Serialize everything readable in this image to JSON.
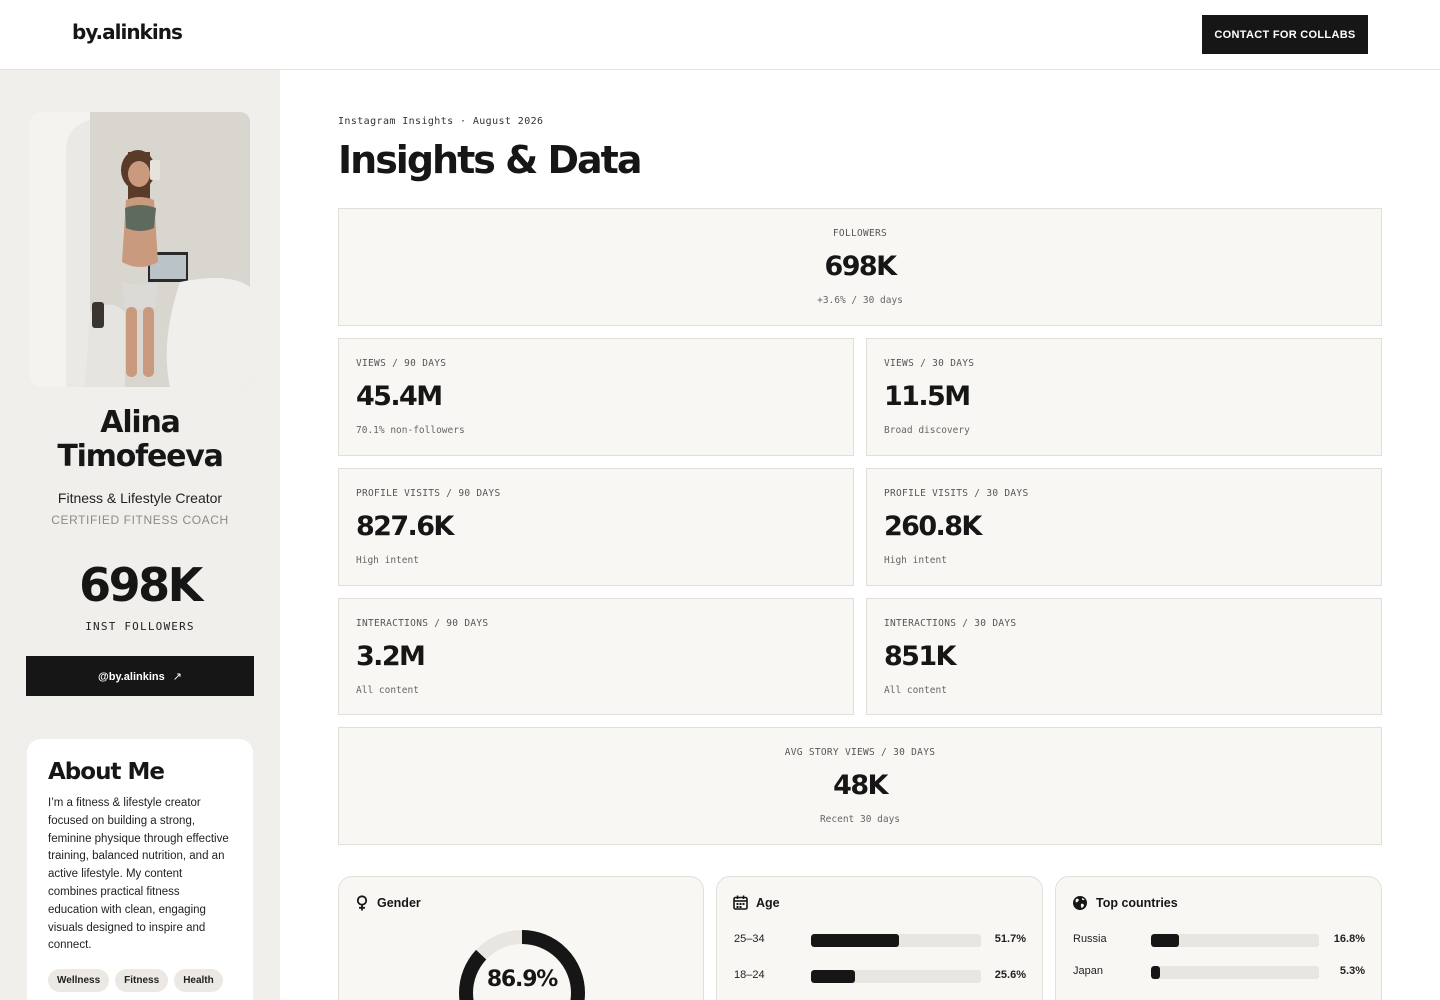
{
  "header": {
    "logo": "by.alinkins",
    "cta_label": "CONTACT FOR COLLABS"
  },
  "profile": {
    "name_line1": "Alina",
    "name_line2": "Timofeeva",
    "role": "Fitness & Lifestyle Creator",
    "certification": "CERTIFIED FITNESS COACH",
    "followers_big": "698K",
    "followers_label": "INST FOLLOWERS",
    "handle_button": "@by.alinkins",
    "handle_arrow": "↗"
  },
  "about": {
    "title": "About Me",
    "text": "I’m a fitness & lifestyle creator focused on building a strong, feminine physique through effective training, balanced nutrition, and an active lifestyle. My content combines practical fitness education with clean, engaging visuals designed to inspire and connect.",
    "tags": [
      "Wellness",
      "Fitness",
      "Health"
    ]
  },
  "main": {
    "eyebrow": "Instagram Insights · August 2026",
    "title": "Insights & Data"
  },
  "metrics": {
    "followers": {
      "label": "FOLLOWERS",
      "value": "698K",
      "sub": "+3.6% / 30 days"
    },
    "views_90": {
      "label": "VIEWS / 90 DAYS",
      "value": "45.4M",
      "sub": "70.1% non-followers"
    },
    "views_30": {
      "label": "VIEWS / 30 DAYS",
      "value": "11.5M",
      "sub": "Broad discovery"
    },
    "visits_90": {
      "label": "PROFILE VISITS / 90 DAYS",
      "value": "827.6K",
      "sub": "High intent"
    },
    "visits_30": {
      "label": "PROFILE VISITS / 30 DAYS",
      "value": "260.8K",
      "sub": "High intent"
    },
    "interactions_90": {
      "label": "INTERACTIONS / 90 DAYS",
      "value": "3.2M",
      "sub": "All content"
    },
    "interactions_30": {
      "label": "INTERACTIONS / 30 DAYS",
      "value": "851K",
      "sub": "All content"
    },
    "story_views": {
      "label": "AVG STORY VIEWS / 30 DAYS",
      "value": "48K",
      "sub": "Recent 30 days"
    }
  },
  "gender": {
    "title": "Gender",
    "icon": "female-icon",
    "women_share": 0.869,
    "value_text": "86.9%"
  },
  "age": {
    "title": "Age",
    "icon": "calendar-icon",
    "rows": [
      {
        "label": "25–34",
        "pct": 51.7,
        "pct_text": "51.7%"
      },
      {
        "label": "18–24",
        "pct": 25.6,
        "pct_text": "25.6%"
      }
    ]
  },
  "countries": {
    "title": "Top countries",
    "icon": "globe-icon",
    "rows": [
      {
        "label": "Russia",
        "pct": 16.8,
        "pct_text": "16.8%"
      },
      {
        "label": "Japan",
        "pct": 5.3,
        "pct_text": "5.3%"
      }
    ]
  },
  "colors": {
    "ink": "#161616",
    "sidebar_bg": "#f1efeb",
    "card_bg": "#f8f7f4",
    "track": "#e9e5e0"
  }
}
